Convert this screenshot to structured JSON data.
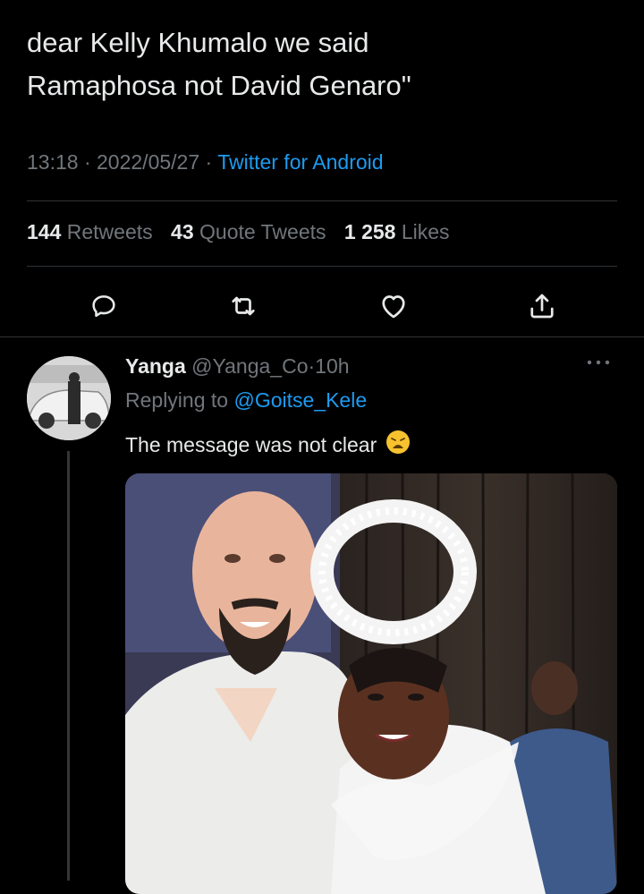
{
  "tweet": {
    "text_line1": "dear Kelly Khumalo we said",
    "text_line2": "Ramaphosa not David Genaro\"",
    "time": "13:18",
    "date": "2022/05/27",
    "source": "Twitter for Android",
    "sep": "·"
  },
  "stats": {
    "retweets_count": "144",
    "retweets_label": "Retweets",
    "quotes_count": "43",
    "quotes_label": "Quote Tweets",
    "likes_count": "1 258",
    "likes_label": "Likes"
  },
  "actions": {
    "icons": [
      "reply-icon",
      "retweet-icon",
      "like-icon",
      "share-icon"
    ]
  },
  "reply": {
    "name": "Yanga",
    "handle": "@Yanga_Co",
    "sep": "·",
    "age": "10h",
    "replying_prefix": "Replying to",
    "replying_handle": "@Goitse_Kele",
    "text": "The message was not clear",
    "emoji": "weary-face-emoji",
    "more_icon": "more-icon"
  },
  "colors": {
    "background": "#000000",
    "text": "#e7e9ea",
    "muted": "#71767b",
    "link": "#1d9bf0",
    "divider": "#2f3336"
  }
}
